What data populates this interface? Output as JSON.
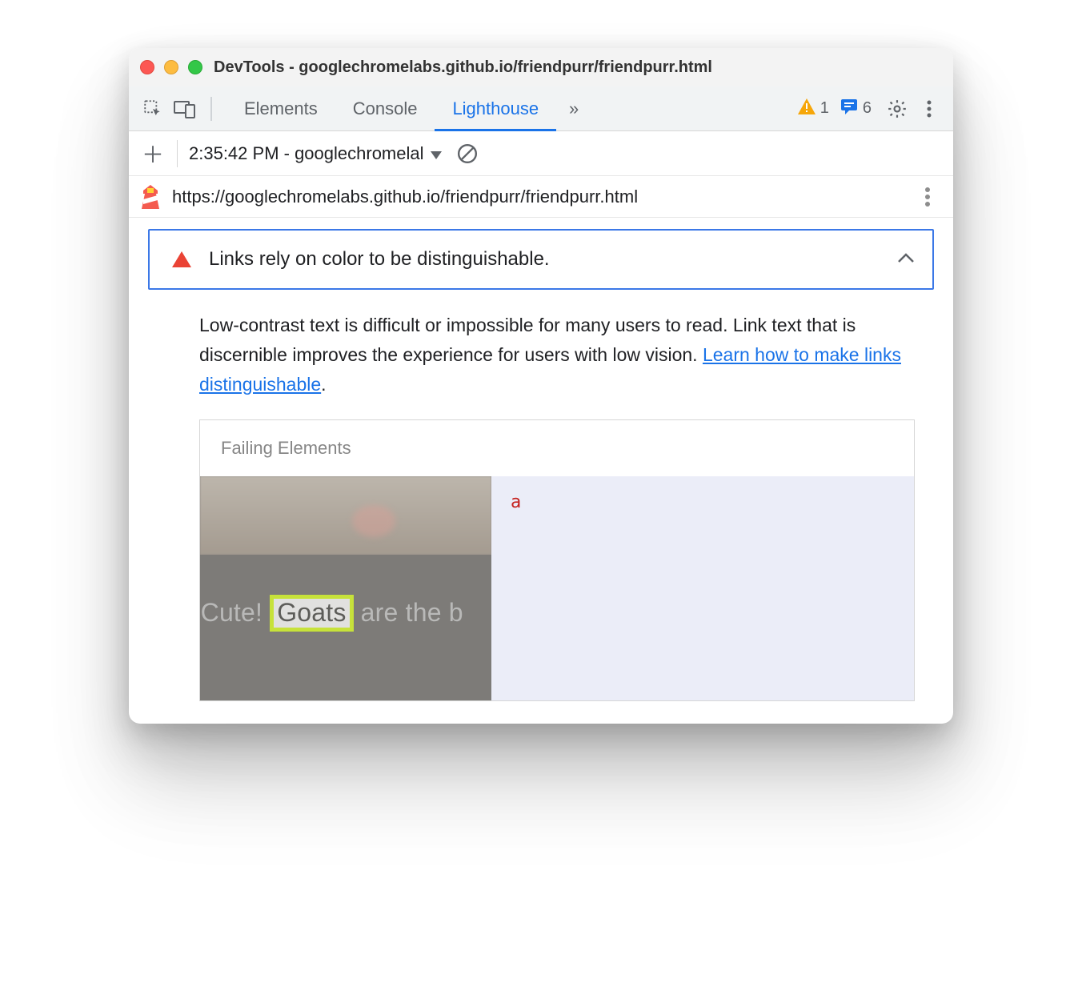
{
  "window": {
    "title": "DevTools - googlechromelabs.github.io/friendpurr/friendpurr.html"
  },
  "tabs": {
    "elements": "Elements",
    "console": "Console",
    "lighthouse": "Lighthouse"
  },
  "toolbar": {
    "more_tabs_glyph": "»",
    "warn_count": "1",
    "msg_count": "6"
  },
  "report_selector": {
    "label": "2:35:42 PM - googlechromelal"
  },
  "urlbar": {
    "url": "https://googlechromelabs.github.io/friendpurr/friendpurr.html"
  },
  "audit": {
    "title": "Links rely on color to be distinguishable.",
    "description_pre": "Low-contrast text is difficult or impossible for many users to read. Link text that is discernible improves the experience for users with low vision. ",
    "description_link": "Learn how to make links distinguishable",
    "description_post": "."
  },
  "panel": {
    "title": "Failing Elements",
    "thumb_text_pre": "So Cute! ",
    "thumb_highlight": "Goats",
    "thumb_text_post": " are the b",
    "element_tag": "a"
  }
}
